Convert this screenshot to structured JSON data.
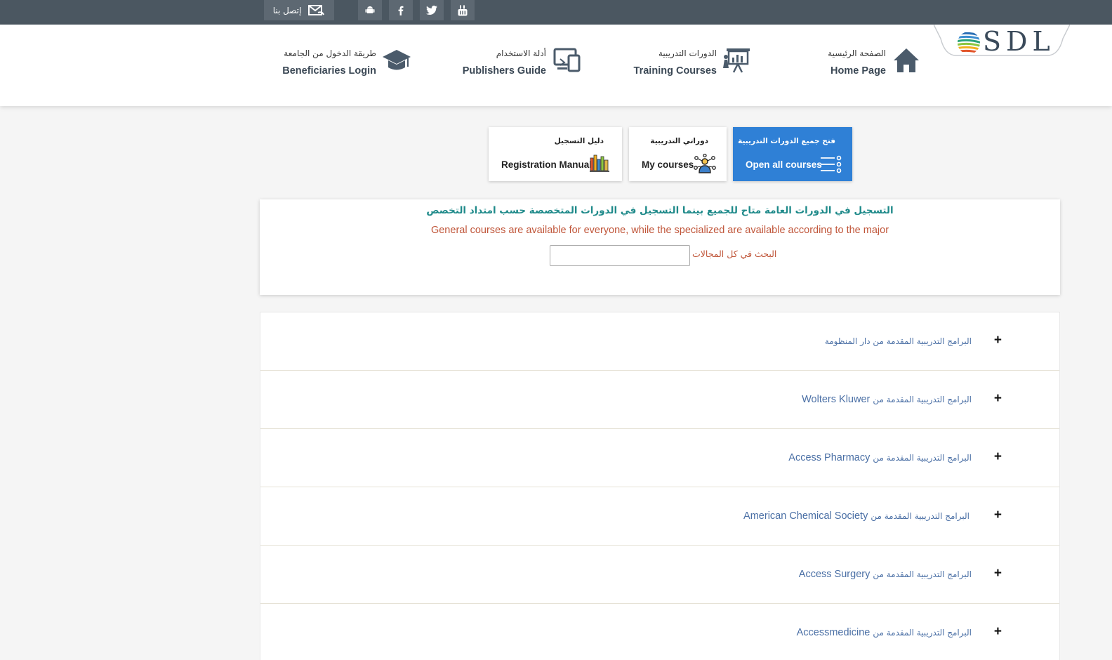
{
  "topbar": {
    "contact_label": "إتصل بنا",
    "icons": [
      "mail-icon",
      "android-icon",
      "facebook-icon",
      "twitter-icon",
      "youtube-icon"
    ]
  },
  "logo": {
    "text": "SDL"
  },
  "nav": {
    "home": {
      "ar": "الصفحة الرئيسية",
      "en": "Home Page"
    },
    "training": {
      "ar": "الدورات التدريبية",
      "en": "Training Courses"
    },
    "publishers": {
      "ar": "أدلة الاستخدام",
      "en": "Publishers Guide"
    },
    "login": {
      "ar": "طريقة الدخول من الجامعة",
      "en": "Beneficiaries Login"
    }
  },
  "cards": {
    "open_all": {
      "ar": "فتح جميع الدورات التدريبية",
      "en": "Open all courses"
    },
    "my_courses": {
      "ar": "دوراتي التدريبية",
      "en": "My courses"
    },
    "manual": {
      "ar": "دليل التسجيل",
      "en": "Registration Manual"
    }
  },
  "notice": {
    "ar": "التسجيل في الدورات العامة متاح للجميع بينما التسجيل في الدورات المتخصصة حسب امتداد التخصص",
    "en": "General courses are available for everyone, while the specialized are available according to the major",
    "search_label": "البحث في كل المجالات",
    "search_value": ""
  },
  "accordion": [
    {
      "ar": "البرامج التدريبية المقدمة من دار المنظومة",
      "en": ""
    },
    {
      "ar": "البرامج التدريبية المقدمة من",
      "en": "Wolters Kluwer"
    },
    {
      "ar": "البرامج التدريبية المقدمة من",
      "en": "Access Pharmacy"
    },
    {
      "ar": "البرامج التدريبية المقدمة من",
      "en": "American Chemical Society"
    },
    {
      "ar": "البرامج التدريبية المقدمة من",
      "en": "Access Surgery"
    },
    {
      "ar": "البرامج التدريبية المقدمة من",
      "en": "Accessmedicine"
    }
  ],
  "expand_symbol": "+",
  "colors": {
    "topbar": "#4b5761",
    "accent_blue": "#2f80d6",
    "notice_teal": "#1f8a8a",
    "notice_red": "#c0563a",
    "link_blue": "#4a6fa5"
  }
}
